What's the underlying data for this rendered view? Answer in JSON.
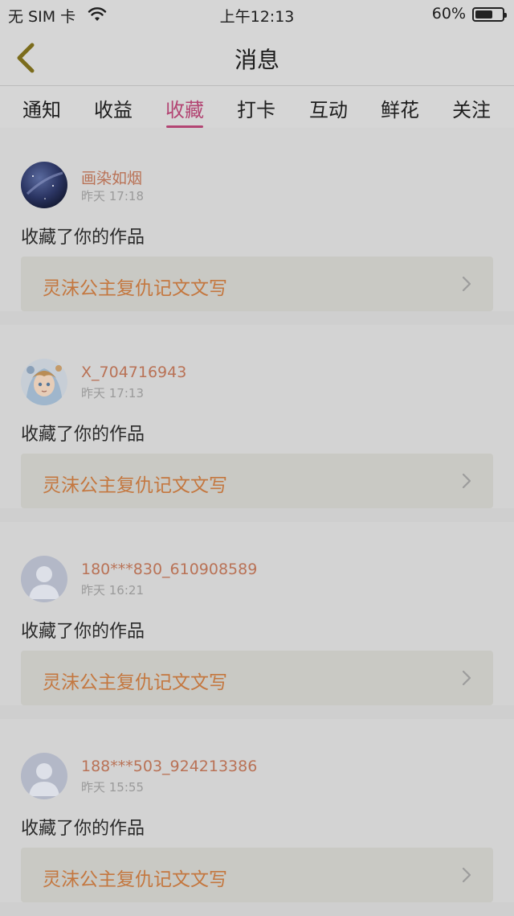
{
  "status_bar": {
    "carrier": "无 SIM 卡",
    "time": "上午12:13",
    "battery": "60%",
    "battery_level": 0.6
  },
  "nav": {
    "title": "消息",
    "back_icon": "chevron-left-icon",
    "accent_color": "#b34573"
  },
  "tabs": [
    {
      "label": "通知",
      "active": false
    },
    {
      "label": "收益",
      "active": false
    },
    {
      "label": "收藏",
      "active": true
    },
    {
      "label": "打卡",
      "active": false
    },
    {
      "label": "互动",
      "active": false
    },
    {
      "label": "鲜花",
      "active": false
    },
    {
      "label": "关注",
      "active": false
    }
  ],
  "messages": [
    {
      "user": "画染如烟",
      "time": "昨天 17:18",
      "action": "收藏了你的作品",
      "work": "灵沫公主复仇记文文写",
      "avatar": "starry-night-avatar"
    },
    {
      "user": "X_704716943",
      "time": "昨天 17:13",
      "action": "收藏了你的作品",
      "work": "灵沫公主复仇记文文写",
      "avatar": "anime-girl-avatar"
    },
    {
      "user": "180***830_610908589",
      "time": "昨天 16:21",
      "action": "收藏了你的作品",
      "work": "灵沫公主复仇记文文写",
      "avatar": "default-user-avatar"
    },
    {
      "user": "188***503_924213386",
      "time": "昨天 15:55",
      "action": "收藏了你的作品",
      "work": "灵沫公主复仇记文文写",
      "avatar": "default-user-avatar"
    }
  ]
}
